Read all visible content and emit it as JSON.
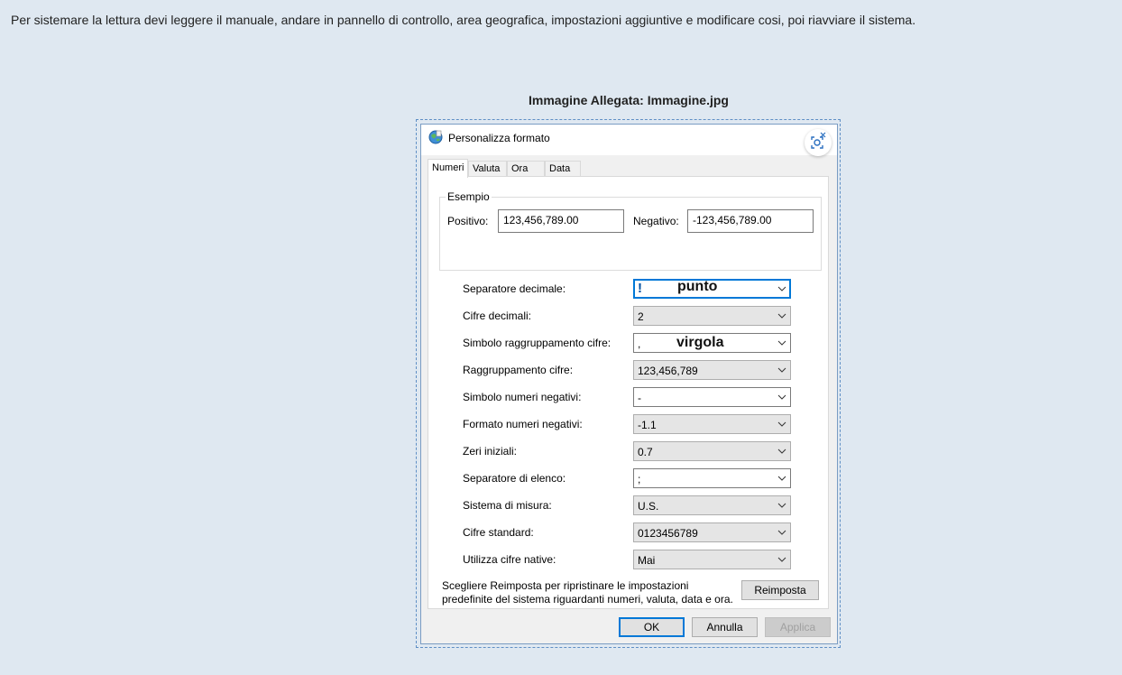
{
  "intro_text": "Per sistemare la lettura devi leggere il manuale, andare in pannello di controllo, area geografica, impostazioni aggiuntive e modificare cosi, poi riavviare il sistema.",
  "attachment_title": "Immagine Allegata: Immagine.jpg",
  "dialog": {
    "title": "Personalizza formato",
    "tabs": [
      "Numeri",
      "Valuta",
      "Ora",
      "Data"
    ],
    "active_tab": "Numeri",
    "example_group": {
      "legend": "Esempio",
      "positive_label": "Positivo:",
      "positive_value": "123,456,789.00",
      "negative_label": "Negativo:",
      "negative_value": "-123,456,789.00"
    },
    "settings": [
      {
        "label": "Separatore decimale:",
        "value": "!",
        "annotation": "punto",
        "style": "focus"
      },
      {
        "label": "Cifre decimali:",
        "value": "2",
        "annotation": "",
        "style": "gray"
      },
      {
        "label": "Simbolo raggruppamento cifre:",
        "value": ",",
        "annotation": "virgola",
        "style": "white"
      },
      {
        "label": "Raggruppamento cifre:",
        "value": "123,456,789",
        "annotation": "",
        "style": "gray"
      },
      {
        "label": "Simbolo numeri negativi:",
        "value": "-",
        "annotation": "",
        "style": "white"
      },
      {
        "label": "Formato numeri negativi:",
        "value": "-1.1",
        "annotation": "",
        "style": "gray"
      },
      {
        "label": "Zeri iniziali:",
        "value": "0.7",
        "annotation": "",
        "style": "gray"
      },
      {
        "label": "Separatore di elenco:",
        "value": ";",
        "annotation": "",
        "style": "white"
      },
      {
        "label": "Sistema di misura:",
        "value": "U.S.",
        "annotation": "",
        "style": "gray"
      },
      {
        "label": "Cifre standard:",
        "value": "0123456789",
        "annotation": "",
        "style": "gray"
      },
      {
        "label": "Utilizza cifre native:",
        "value": "Mai",
        "annotation": "",
        "style": "gray"
      }
    ],
    "reset_note_line1": "Scegliere Reimposta per ripristinare le impostazioni",
    "reset_note_line2": "predefinite del sistema riguardanti numeri, valuta, data e ora.",
    "reset_button": "Reimposta",
    "ok_button": "OK",
    "cancel_button": "Annulla",
    "apply_button": "Applica"
  },
  "colors": {
    "page_background": "#dfe8f1",
    "dialog_border": "#7a9cc3",
    "focus_blue": "#0078d7",
    "dashed_frame": "#5f8fc5"
  }
}
